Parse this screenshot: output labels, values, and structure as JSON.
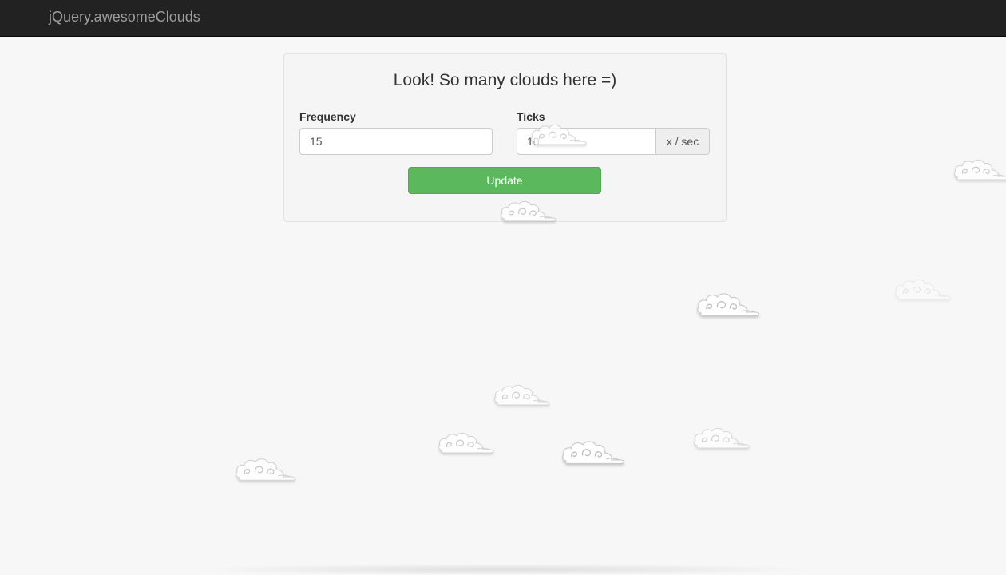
{
  "navbar": {
    "brand": "jQuery.awesomeClouds"
  },
  "panel": {
    "title": "Look! So many clouds here =)",
    "frequency": {
      "label": "Frequency",
      "value": "15"
    },
    "ticks": {
      "label": "Ticks",
      "value": "10",
      "unit": "x / sec"
    },
    "update_button": "Update"
  },
  "colors": {
    "navbar_bg": "#222222",
    "brand_text": "#9d9d9d",
    "page_bg": "#f7f7f7",
    "button_success": "#5cb85c"
  },
  "decorations": {
    "cloud_icon": "cloud-icon"
  }
}
